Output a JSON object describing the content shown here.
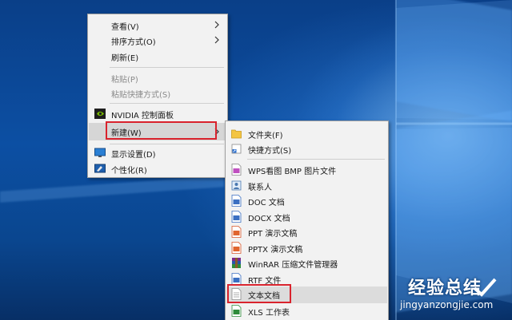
{
  "context_menu": {
    "items": [
      {
        "label": "查看(V)",
        "has_submenu": true,
        "disabled": false
      },
      {
        "label": "排序方式(O)",
        "has_submenu": true,
        "disabled": false
      },
      {
        "label": "刷新(E)",
        "has_submenu": false,
        "disabled": false
      },
      {
        "label": "粘贴(P)",
        "has_submenu": false,
        "disabled": true
      },
      {
        "label": "粘贴快捷方式(S)",
        "has_submenu": false,
        "disabled": true
      },
      {
        "label": "NVIDIA 控制面板",
        "icon": "nvidia-icon",
        "disabled": false
      },
      {
        "label": "新建(W)",
        "has_submenu": true,
        "highlighted": true,
        "disabled": false
      },
      {
        "label": "显示设置(D)",
        "icon": "display-icon",
        "disabled": false
      },
      {
        "label": "个性化(R)",
        "icon": "personalize-icon",
        "disabled": false
      }
    ]
  },
  "new_submenu": {
    "items": [
      {
        "label": "文件夹(F)",
        "icon": "folder-icon"
      },
      {
        "label": "快捷方式(S)",
        "icon": "shortcut-icon"
      },
      {
        "label": "WPS看图 BMP 图片文件",
        "icon": "bmp-file-icon"
      },
      {
        "label": "联系人",
        "icon": "contact-icon"
      },
      {
        "label": "DOC 文档",
        "icon": "doc-file-icon"
      },
      {
        "label": "DOCX 文档",
        "icon": "docx-file-icon"
      },
      {
        "label": "PPT 演示文稿",
        "icon": "ppt-file-icon"
      },
      {
        "label": "PPTX 演示文稿",
        "icon": "pptx-file-icon"
      },
      {
        "label": "WinRAR 压缩文件管理器",
        "icon": "winrar-icon"
      },
      {
        "label": "RTF 文件",
        "icon": "rtf-file-icon"
      },
      {
        "label": "文本文档",
        "icon": "text-file-icon",
        "highlighted": true
      },
      {
        "label": "XLS 工作表",
        "icon": "xls-file-icon"
      }
    ]
  },
  "watermark": {
    "title": "经验总结",
    "url": "jingyanzongjie.com"
  },
  "colors": {
    "highlight_box": "#d9232d",
    "menu_bg": "#f2f2f2",
    "desktop_blue": "#0c4fa3"
  }
}
